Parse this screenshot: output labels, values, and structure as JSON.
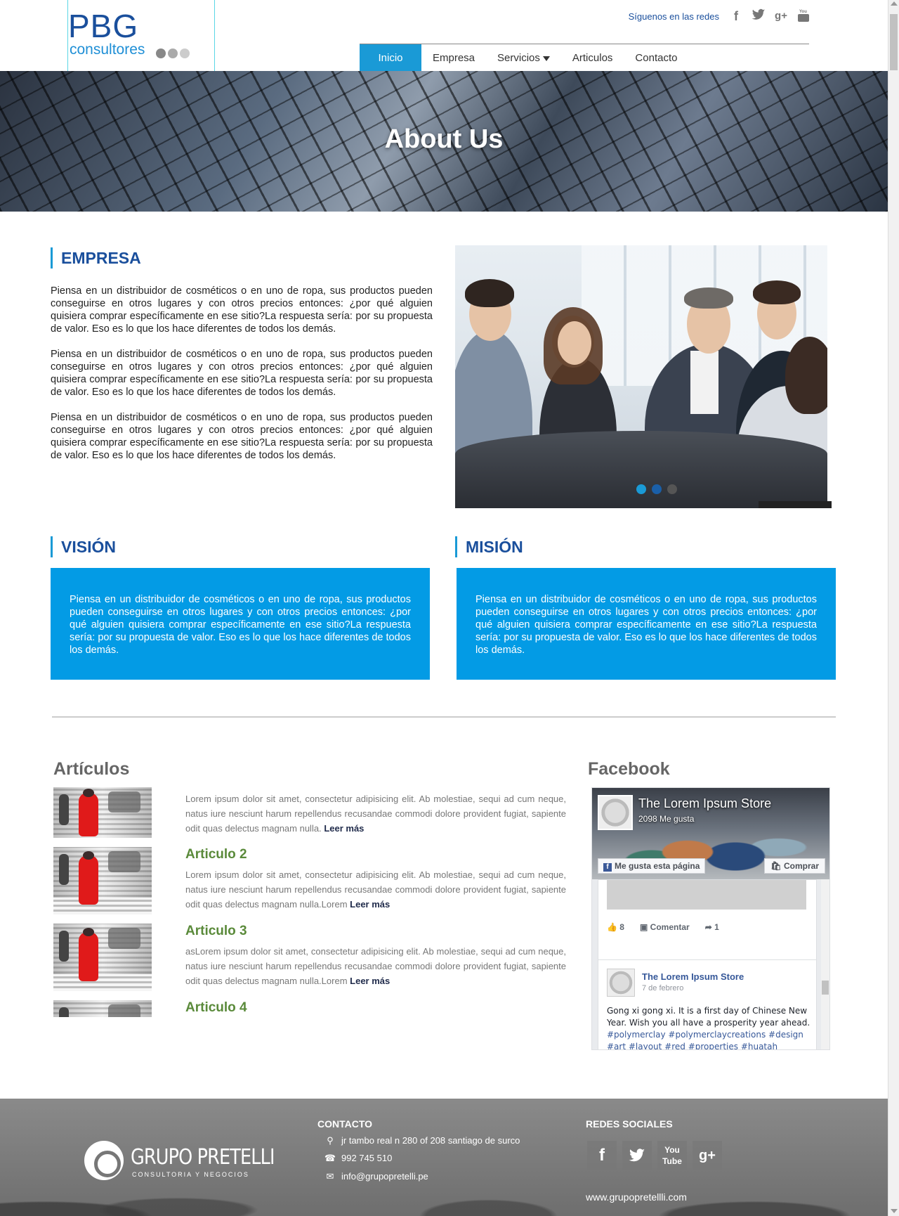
{
  "header": {
    "logo_main": "PBG",
    "logo_sub": "consultores",
    "follow_text": "Síguenos en las redes",
    "nav": [
      {
        "label": "Inicio",
        "active": true
      },
      {
        "label": "Empresa"
      },
      {
        "label": "Servicios"
      },
      {
        "label": "Articulos"
      },
      {
        "label": "Contacto"
      }
    ],
    "social_icons": [
      "facebook-icon",
      "twitter-icon",
      "google-plus-icon",
      "youtube-icon"
    ]
  },
  "hero": {
    "title": "About Us"
  },
  "empresa": {
    "title": "EMPRESA",
    "paragraphs": [
      "Piensa en un distribuidor de cosméticos o en uno de ropa, sus productos pueden conseguirse en otros lugares y con otros precios entonces: ¿por qué alguien quisiera comprar específicamente en ese sitio?La respuesta sería: por su propuesta de valor. Eso es lo que los hace diferentes de todos los demás.",
      "Piensa en un distribuidor de cosméticos o en uno de ropa, sus productos pueden conseguirse en otros lugares y con otros precios entonces: ¿por qué alguien quisiera comprar específicamente en ese sitio?La respuesta sería: por su propuesta de valor. Eso es lo que los hace diferentes de todos los demás.",
      "Piensa en un distribuidor de cosméticos o en uno de ropa, sus productos pueden conseguirse en otros lugares y con otros precios entonces: ¿por qué alguien quisiera comprar específicamente en ese sitio?La respuesta sería: por su propuesta de valor. Eso es lo que los hace diferentes de todos los demás."
    ],
    "slider_dots": 3,
    "slider_active": 0
  },
  "vision": {
    "title": "VISIÓN",
    "text": "Piensa en un distribuidor de cosméticos o en uno de ropa, sus productos pueden conseguirse en otros lugares y con otros precios entonces: ¿por qué alguien quisiera comprar específicamente en ese sitio?La respuesta sería: por su propuesta de valor. Eso es lo que los hace diferentes de todos los demás."
  },
  "mision": {
    "title": "MISIÓN",
    "text": "Piensa en un distribuidor de cosméticos o en uno de ropa, sus productos pueden conseguirse en otros lugares y con otros precios entonces: ¿por qué alguien quisiera comprar específicamente en ese sitio?La respuesta sería: por su propuesta de valor. Eso es lo que los hace diferentes de todos los demás."
  },
  "articulos": {
    "title": "Artículos",
    "read_more": "Leer más",
    "items": [
      {
        "name": "",
        "text": "Lorem ipsum dolor sit amet, consectetur adipisicing elit. Ab molestiae, sequi ad cum neque, natus iure nesciunt harum repellendus recusandae commodi dolore provident fugiat, sapiente odit quas delectus magnam nulla."
      },
      {
        "name": "Articulo 2",
        "text": "Lorem ipsum dolor sit amet, consectetur adipisicing elit. Ab molestiae, sequi ad cum neque, natus iure nesciunt harum repellendus recusandae commodi dolore provident fugiat, sapiente odit quas delectus magnam nulla.Lorem"
      },
      {
        "name": "Articulo 3",
        "text": "asLorem ipsum dolor sit amet, consectetur adipisicing elit. Ab molestiae, sequi ad cum neque, natus iure nesciunt harum repellendus recusandae commodi dolore provident fugiat, sapiente odit quas delectus magnam nulla.Lorem"
      },
      {
        "name": "Articulo 4",
        "text": ""
      }
    ]
  },
  "facebook": {
    "title": "Facebook",
    "page_name": "The Lorem Ipsum Store",
    "likes": "2098 Me gusta",
    "like_btn": "Me gusta esta página",
    "buy_btn": "Comprar",
    "post_likes": "8",
    "comment": "Comentar",
    "shares": "1",
    "post_author": "The Lorem Ipsum Store",
    "post_date": "7 de febrero",
    "post_text": "Gong xi gong xi. It is a first day of Chinese New Year. Wish you all have a prosperity year ahead.",
    "post_tags": "#polymerclay #polymerclaycreations #design #art #layout #red #properties #huatah"
  },
  "footer": {
    "brand": "GRUPO PRETELLI",
    "brand_sub": "CONSULTORIA Y NEGOCIOS",
    "contact_title": "CONTACTO",
    "address": "jr tambo real n 280 of 208 santiago de surco",
    "phone": "992 745 510",
    "email": "info@grupopretelli.pe",
    "social_title": "REDES SOCIALES",
    "website": "www.grupopretellli.com"
  },
  "colors": {
    "brand_blue": "#1a4f9c",
    "accent_blue": "#1a9ad6",
    "box_blue": "#039be5",
    "article_green": "#5a8a3a"
  }
}
